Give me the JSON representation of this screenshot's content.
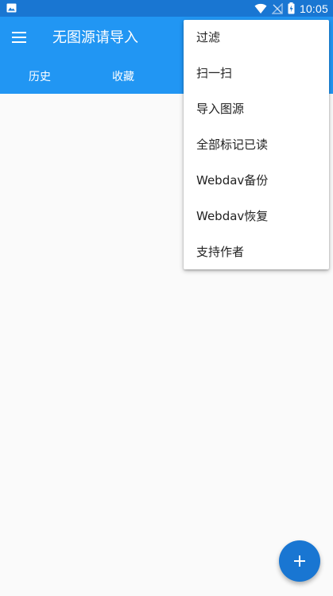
{
  "status_bar": {
    "time": "10:05",
    "icons": [
      "image-notification-icon",
      "wifi-icon",
      "no-signal-icon",
      "battery-charging-icon"
    ]
  },
  "app_bar": {
    "title": "无图源请导入",
    "menu_icon": "hamburger-menu-icon",
    "tabs": [
      {
        "label": "历史"
      },
      {
        "label": "收藏"
      }
    ]
  },
  "popup_menu": {
    "items": [
      {
        "label": "过滤"
      },
      {
        "label": "扫一扫"
      },
      {
        "label": "导入图源"
      },
      {
        "label": "全部标记已读"
      },
      {
        "label": "Webdav备份"
      },
      {
        "label": "Webdav恢复"
      },
      {
        "label": "支持作者"
      }
    ]
  },
  "fab": {
    "icon": "plus-icon"
  },
  "colors": {
    "status_bar": "#1976d2",
    "app_bar": "#2196f3",
    "fab": "#1976d2",
    "background": "#fafafa"
  }
}
